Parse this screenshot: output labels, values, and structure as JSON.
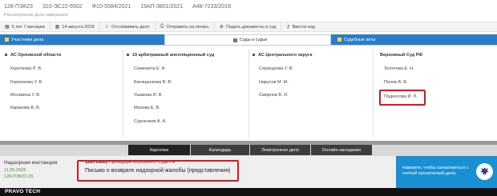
{
  "header": {
    "case_numbers": [
      "128-ПЭК23",
      "310-ЭС22-6502",
      "Ф10-5584/2021",
      "19АП-3801/2021",
      "А48-7233/2018"
    ],
    "status": "Рассмотрение дела завершено"
  },
  "toolbar": {
    "items": [
      {
        "icon": "calendar-icon",
        "label": "5 лет 7 месяцев"
      },
      {
        "icon": "calendar-icon",
        "label": "14 августа 2018"
      },
      {
        "icon": "star-icon",
        "label": "Отслеживать дело"
      },
      {
        "icon": "print-icon",
        "label": "Отправить на печать"
      },
      {
        "icon": "plus-icon",
        "label": "Подать документы в суд"
      },
      {
        "icon": "key-icon",
        "label": "Ввести код"
      }
    ]
  },
  "tabs": {
    "participants": "Участники дела",
    "courts": "Суды и судьи",
    "acts": "Судебные акты"
  },
  "courts": [
    {
      "name": "АС Орловской области",
      "judges": [
        "Короткова Л. В.",
        "Корнюхова У. В.",
        "Москвина У. В.",
        "Каракова В. В."
      ]
    },
    {
      "name": "19 арбитражный апелляционный суд",
      "judges": [
        "Семенюта Е. А.",
        "Батищенкова В. В.",
        "Ушакова И. В.",
        "Махова Е. В.",
        "Сурненков А. А."
      ]
    },
    {
      "name": "АС Центрального округа",
      "judges": [
        "Серокурова У. В.",
        "Нарусов М. М.",
        "Смирнов В. И."
      ]
    },
    {
      "name": "Верховный Суд РФ",
      "judges": [
        "Золотова Е. Н.",
        "Попов В. В.",
        "Подносова И. Л."
      ],
      "highlighted_judge": "Подносова И. Л."
    }
  ],
  "nav": {
    "buttons": [
      "Карточка",
      "Календарь",
      "Электронное дело",
      "Онлайн-заседания"
    ],
    "active": "Карточка"
  },
  "instance": {
    "title": "Надзорная инстанция",
    "date": "11.05.2023",
    "number": "128-ПЭК23 (3)"
  },
  "document": {
    "case_number": "128-ПЭК23",
    "court": "Президиум Верховного Суда РФ",
    "title": "Письмо о возврате надзорной жалобы (представления)"
  },
  "cta": {
    "text": "Нажмите, чтобы ознакомиться с полной хронологией дела."
  },
  "footer": {
    "logo": "PRAVO TECH"
  },
  "colors": {
    "accent_blue": "#2a7ec9",
    "cta_blue": "#1a90d4",
    "highlight_red": "#d71920",
    "date_green": "#4a8a3a"
  }
}
